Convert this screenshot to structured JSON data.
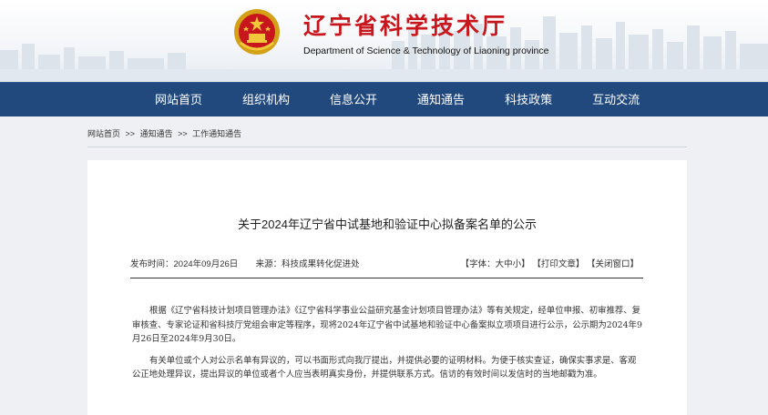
{
  "header": {
    "title": "辽宁省科学技术厅",
    "subtitle": "Department of Science & Technology of Liaoning province",
    "colors": {
      "title": "#c8161d",
      "nav_bg": "#22497e"
    }
  },
  "nav": {
    "items": [
      {
        "label": "网站首页"
      },
      {
        "label": "组织机构"
      },
      {
        "label": "信息公开"
      },
      {
        "label": "通知通告"
      },
      {
        "label": "科技政策"
      },
      {
        "label": "互动交流"
      }
    ]
  },
  "breadcrumb": {
    "items": [
      "网站首页",
      "通知通告",
      "工作通知通告"
    ],
    "separator": ">>"
  },
  "article": {
    "title": "关于2024年辽宁省中试基地和验证中心拟备案名单的公示",
    "publish_label": "发布时间：2024年09月26日",
    "source_label": "来源：科技成果转化促进处",
    "font_size_tool": "【字体：大中小】",
    "print_tool": "【打印文章】",
    "close_tool": "【关闭窗口】",
    "paragraphs": [
      "根据《辽宁省科技计划项目管理办法》《辽宁省科学事业公益研究基金计划项目管理办法》等有关规定，经单位申报、初审推荐、复审核查、专家论证和省科技厅党组会审定等程序，现将2024年辽宁省中试基地和验证中心备案拟立项项目进行公示，公示期为2024年9月26日至2024年9月30日。",
      "有关单位或个人对公示名单有异议的，可以书面形式向我厅提出，并提供必要的证明材料。为便于核实查证，确保实事求是、客观公正地处理异议，提出异议的单位或者个人应当表明真实身份，并提供联系方式。信访的有效时间以发信时的当地邮戳为准。"
    ]
  }
}
